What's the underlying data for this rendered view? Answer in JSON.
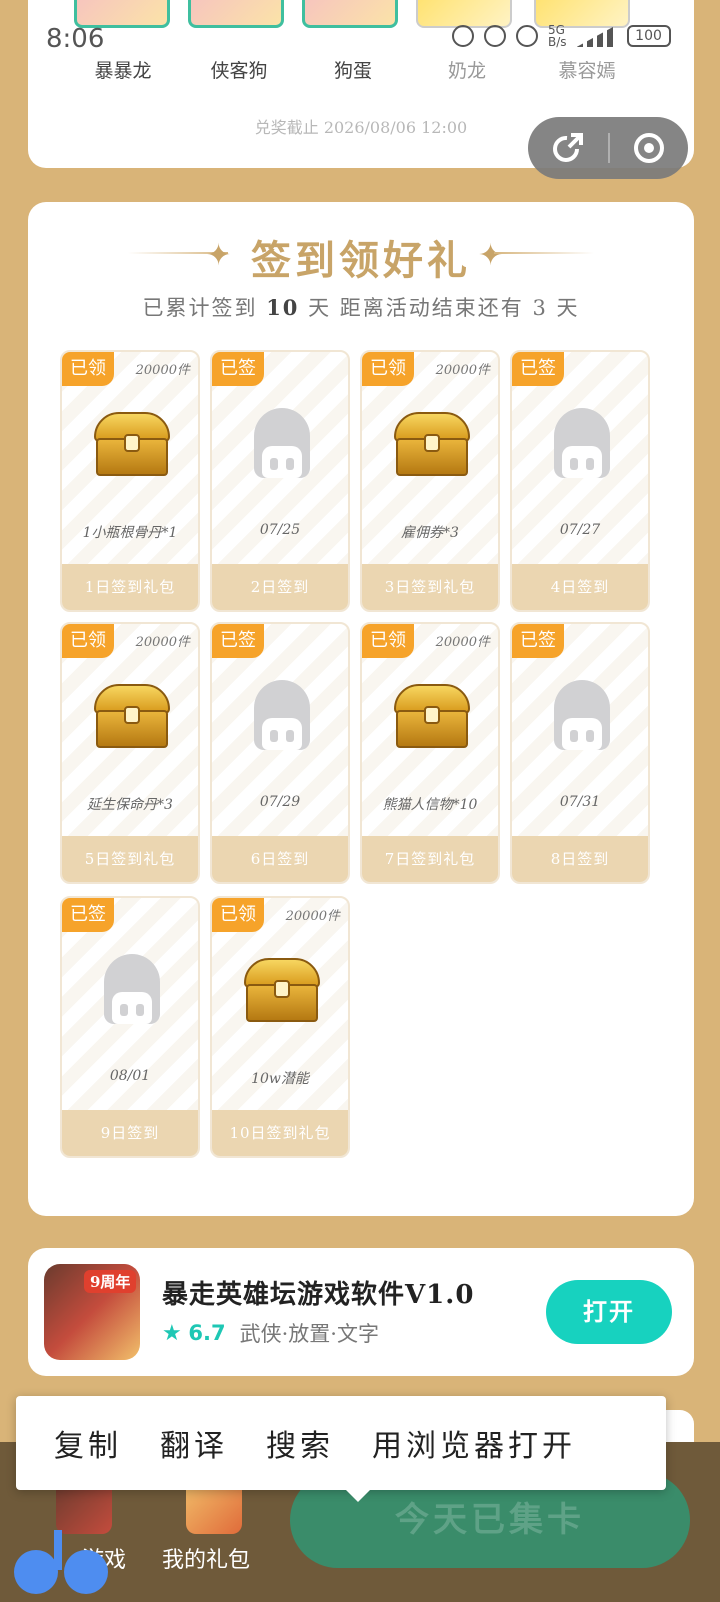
{
  "status_bar": {
    "time": "8:06",
    "network": "B/s",
    "signal": "5G",
    "battery": "100"
  },
  "top_card": {
    "characters": [
      {
        "name": "暴暴龙"
      },
      {
        "name": "侠客狗"
      },
      {
        "name": "狗蛋"
      },
      {
        "name": "奶龙"
      },
      {
        "name": "慕容嫣"
      }
    ],
    "deadline": "兑奖截止 2026/08/06 12:00"
  },
  "checkin": {
    "title": "签到领好礼",
    "subtitle_prefix": "已累计签到",
    "days_count": "10",
    "subtitle_suffix": "天  距离活动结束还有 3 天",
    "tiles": [
      {
        "tag": "已领",
        "count": "20000件",
        "type": "chest",
        "label": "1小瓶根骨丹*1",
        "footer": "1日签到礼包"
      },
      {
        "tag": "已签",
        "count": "",
        "type": "placeholder",
        "label": "07/25",
        "footer": "2日签到"
      },
      {
        "tag": "已领",
        "count": "20000件",
        "type": "chest",
        "label": "雇佣券*3",
        "footer": "3日签到礼包"
      },
      {
        "tag": "已签",
        "count": "",
        "type": "placeholder",
        "label": "07/27",
        "footer": "4日签到"
      },
      {
        "tag": "已领",
        "count": "20000件",
        "type": "chest",
        "label": "延生保命丹*3",
        "footer": "5日签到礼包"
      },
      {
        "tag": "已签",
        "count": "",
        "type": "placeholder",
        "label": "07/29",
        "footer": "6日签到"
      },
      {
        "tag": "已领",
        "count": "20000件",
        "type": "chest",
        "label": "熊猫人信物*10",
        "footer": "7日签到礼包"
      },
      {
        "tag": "已签",
        "count": "",
        "type": "placeholder",
        "label": "07/31",
        "footer": "8日签到"
      },
      {
        "tag": "已签",
        "count": "",
        "type": "placeholder",
        "label": "08/01",
        "footer": "9日签到"
      },
      {
        "tag": "已领",
        "count": "20000件",
        "type": "chest",
        "label": "10w潜能",
        "footer": "10日签到礼包"
      }
    ]
  },
  "app_card": {
    "badge": "9周年",
    "name": "暴走英雄坛游戏软件V1.0",
    "rating": "6.7",
    "tags": "武侠·放置·文字",
    "open_label": "打开"
  },
  "context_menu": {
    "items": [
      "复制",
      "翻译",
      "搜索",
      "用浏览器打开"
    ]
  },
  "bottom_bar": {
    "game_label": "游戏",
    "gift_label": "我的礼包",
    "today_label": "今天已集卡"
  },
  "colors": {
    "accent": "#f6a32a",
    "teal": "#17d2bf",
    "gold": "#c8a468",
    "page_bg": "#d9b478"
  }
}
